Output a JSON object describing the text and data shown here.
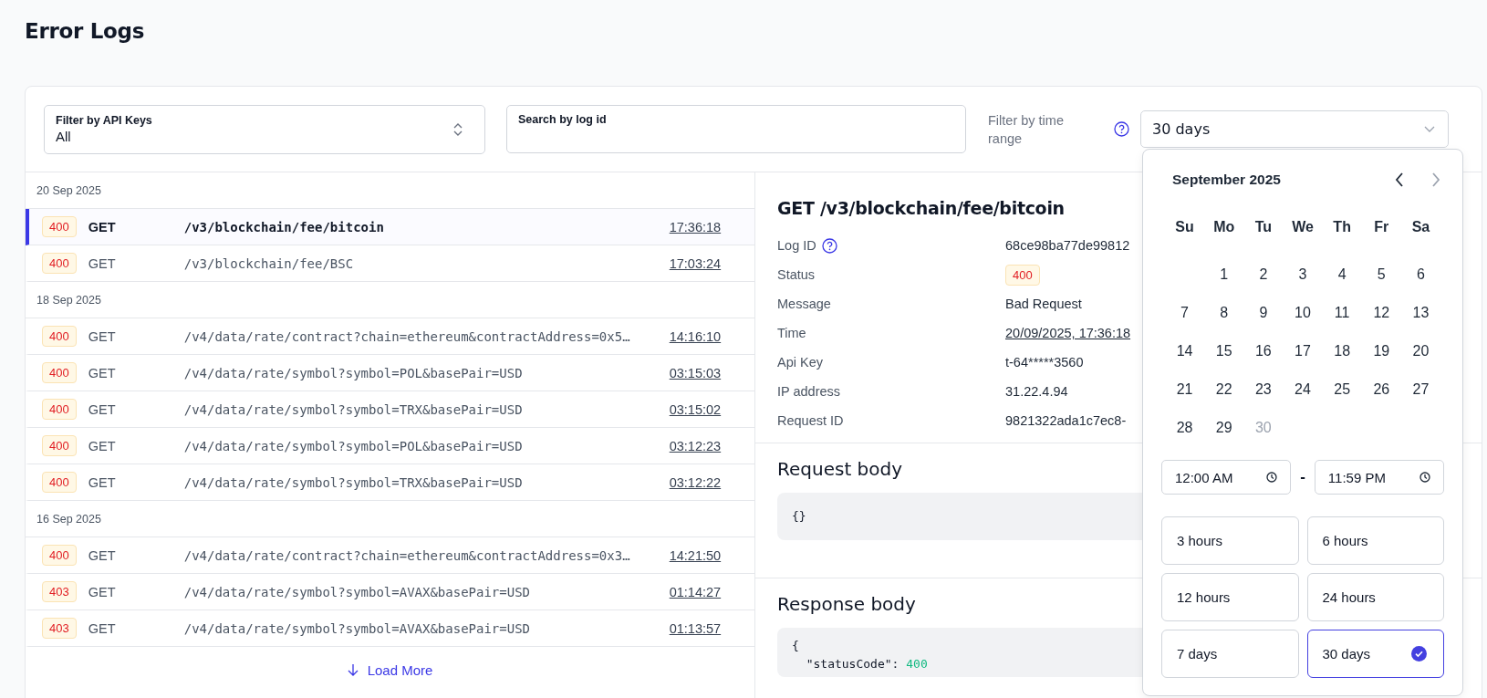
{
  "page": {
    "title": "Error Logs"
  },
  "filters": {
    "api_keys": {
      "label": "Filter by API Keys",
      "value": "All"
    },
    "search": {
      "placeholder": "Search by log id"
    },
    "time_range": {
      "label": "Filter by time range",
      "value": "30 days"
    }
  },
  "log_groups": [
    {
      "date": "20 Sep 2025",
      "rows": [
        {
          "status": "400",
          "method": "GET",
          "path": "/v3/blockchain/fee/bitcoin",
          "time": "17:36:18",
          "selected": true
        },
        {
          "status": "400",
          "method": "GET",
          "path": "/v3/blockchain/fee/BSC",
          "time": "17:03:24",
          "selected": false
        }
      ]
    },
    {
      "date": "18 Sep 2025",
      "rows": [
        {
          "status": "400",
          "method": "GET",
          "path": "/v4/data/rate/contract?chain=ethereum&contractAddress=0x5…",
          "time": "14:16:10",
          "selected": false
        },
        {
          "status": "400",
          "method": "GET",
          "path": "/v4/data/rate/symbol?symbol=POL&basePair=USD",
          "time": "03:15:03",
          "selected": false
        },
        {
          "status": "400",
          "method": "GET",
          "path": "/v4/data/rate/symbol?symbol=TRX&basePair=USD",
          "time": "03:15:02",
          "selected": false
        },
        {
          "status": "400",
          "method": "GET",
          "path": "/v4/data/rate/symbol?symbol=POL&basePair=USD",
          "time": "03:12:23",
          "selected": false
        },
        {
          "status": "400",
          "method": "GET",
          "path": "/v4/data/rate/symbol?symbol=TRX&basePair=USD",
          "time": "03:12:22",
          "selected": false
        }
      ]
    },
    {
      "date": "16 Sep 2025",
      "rows": [
        {
          "status": "400",
          "method": "GET",
          "path": "/v4/data/rate/contract?chain=ethereum&contractAddress=0x3…",
          "time": "14:21:50",
          "selected": false
        },
        {
          "status": "403",
          "method": "GET",
          "path": "/v4/data/rate/symbol?symbol=AVAX&basePair=USD",
          "time": "01:14:27",
          "selected": false
        },
        {
          "status": "403",
          "method": "GET",
          "path": "/v4/data/rate/symbol?symbol=AVAX&basePair=USD",
          "time": "01:13:57",
          "selected": false
        }
      ]
    }
  ],
  "load_more": "Load More",
  "detail": {
    "title": "GET /v3/blockchain/fee/bitcoin",
    "fields": [
      {
        "label": "Log ID",
        "help_icon": true,
        "kind": "text",
        "value": "68ce98ba77de99812"
      },
      {
        "label": "Status",
        "help_icon": false,
        "kind": "badge",
        "value": "400"
      },
      {
        "label": "Message",
        "help_icon": false,
        "kind": "text",
        "value": "Bad Request"
      },
      {
        "label": "Time",
        "help_icon": false,
        "kind": "link",
        "value": "20/09/2025, 17:36:18"
      },
      {
        "label": "Api Key",
        "help_icon": false,
        "kind": "text",
        "value": "t-64*****3560"
      },
      {
        "label": "IP address",
        "help_icon": false,
        "kind": "text",
        "value": "31.22.4.94"
      },
      {
        "label": "Request ID",
        "help_icon": false,
        "kind": "text",
        "value": "9821322ada1c7ec8-"
      }
    ],
    "request_body": {
      "title": "Request body",
      "lines": [
        {
          "kind": "plain",
          "text": "{}"
        }
      ]
    },
    "response_body": {
      "title": "Response body",
      "lines": [
        {
          "kind": "plain",
          "text": "{"
        },
        {
          "kind": "pair",
          "key": "\"statusCode\":",
          "value": "400"
        }
      ]
    }
  },
  "calendar": {
    "month": "September 2025",
    "weekdays": [
      "Su",
      "Mo",
      "Tu",
      "We",
      "Th",
      "Fr",
      "Sa"
    ],
    "days": [
      {
        "label": "1",
        "disabled": false
      },
      {
        "label": "2",
        "disabled": false
      },
      {
        "label": "3",
        "disabled": false
      },
      {
        "label": "4",
        "disabled": false
      },
      {
        "label": "5",
        "disabled": false
      },
      {
        "label": "6",
        "disabled": false
      },
      {
        "label": "7",
        "disabled": false
      },
      {
        "label": "8",
        "disabled": false
      },
      {
        "label": "9",
        "disabled": false
      },
      {
        "label": "10",
        "disabled": false
      },
      {
        "label": "11",
        "disabled": false
      },
      {
        "label": "12",
        "disabled": false
      },
      {
        "label": "13",
        "disabled": false
      },
      {
        "label": "14",
        "disabled": false
      },
      {
        "label": "15",
        "disabled": false
      },
      {
        "label": "16",
        "disabled": false
      },
      {
        "label": "17",
        "disabled": false
      },
      {
        "label": "18",
        "disabled": false
      },
      {
        "label": "19",
        "disabled": false
      },
      {
        "label": "20",
        "disabled": false
      },
      {
        "label": "21",
        "disabled": false
      },
      {
        "label": "22",
        "disabled": false
      },
      {
        "label": "23",
        "disabled": false
      },
      {
        "label": "24",
        "disabled": false
      },
      {
        "label": "25",
        "disabled": false
      },
      {
        "label": "26",
        "disabled": false
      },
      {
        "label": "27",
        "disabled": false
      },
      {
        "label": "28",
        "disabled": false
      },
      {
        "label": "29",
        "disabled": false
      },
      {
        "label": "30",
        "disabled": true
      }
    ],
    "start_time": "12:00 AM",
    "separator": "-",
    "end_time": "11:59 PM",
    "presets": [
      {
        "label": "3 hours",
        "selected": false
      },
      {
        "label": "6 hours",
        "selected": false
      },
      {
        "label": "12 hours",
        "selected": false
      },
      {
        "label": "24 hours",
        "selected": false
      },
      {
        "label": "7 days",
        "selected": false
      },
      {
        "label": "30 days",
        "selected": true
      }
    ]
  }
}
